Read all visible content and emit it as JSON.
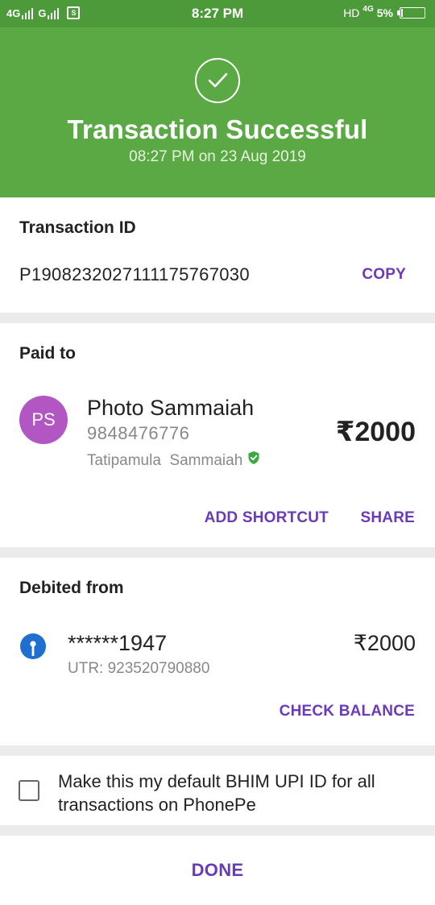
{
  "status_bar": {
    "network_1": "4G",
    "network_2": "G",
    "sim_icon_label": "S",
    "time": "8:27 PM",
    "hd": "HD",
    "network_3": "4G",
    "battery": "5%",
    "battery_level": 0.05
  },
  "header": {
    "icon": "check-circle-icon",
    "title": "Transaction Successful",
    "subtitle": "08:27 PM on 23 Aug 2019",
    "color": "#5ba944"
  },
  "transaction": {
    "title": "Transaction ID",
    "id": "P1908232027111175767030",
    "copy_label": "COPY"
  },
  "paid_to": {
    "title": "Paid to",
    "avatar_initials": "PS",
    "avatar_color": "#b256c4",
    "name": "Photo Sammaiah",
    "phone": "9848476776",
    "legal_name": "Tatipamula  Sammaiah",
    "verified_icon": "verified-shield-icon",
    "amount": "₹2000",
    "add_shortcut_label": "ADD SHORTCUT",
    "share_label": "SHARE"
  },
  "debited_from": {
    "title": "Debited from",
    "bank_icon": "sbi-bank-icon",
    "account": "******1947",
    "utr": "UTR: 923520790880",
    "amount": "₹2000",
    "check_balance_label": "CHECK BALANCE"
  },
  "default_upi": {
    "checked": false,
    "text": "Make this my default BHIM UPI ID for all transactions on PhonePe"
  },
  "footer": {
    "done_label": "DONE"
  },
  "accent_color": "#6a3bb8"
}
